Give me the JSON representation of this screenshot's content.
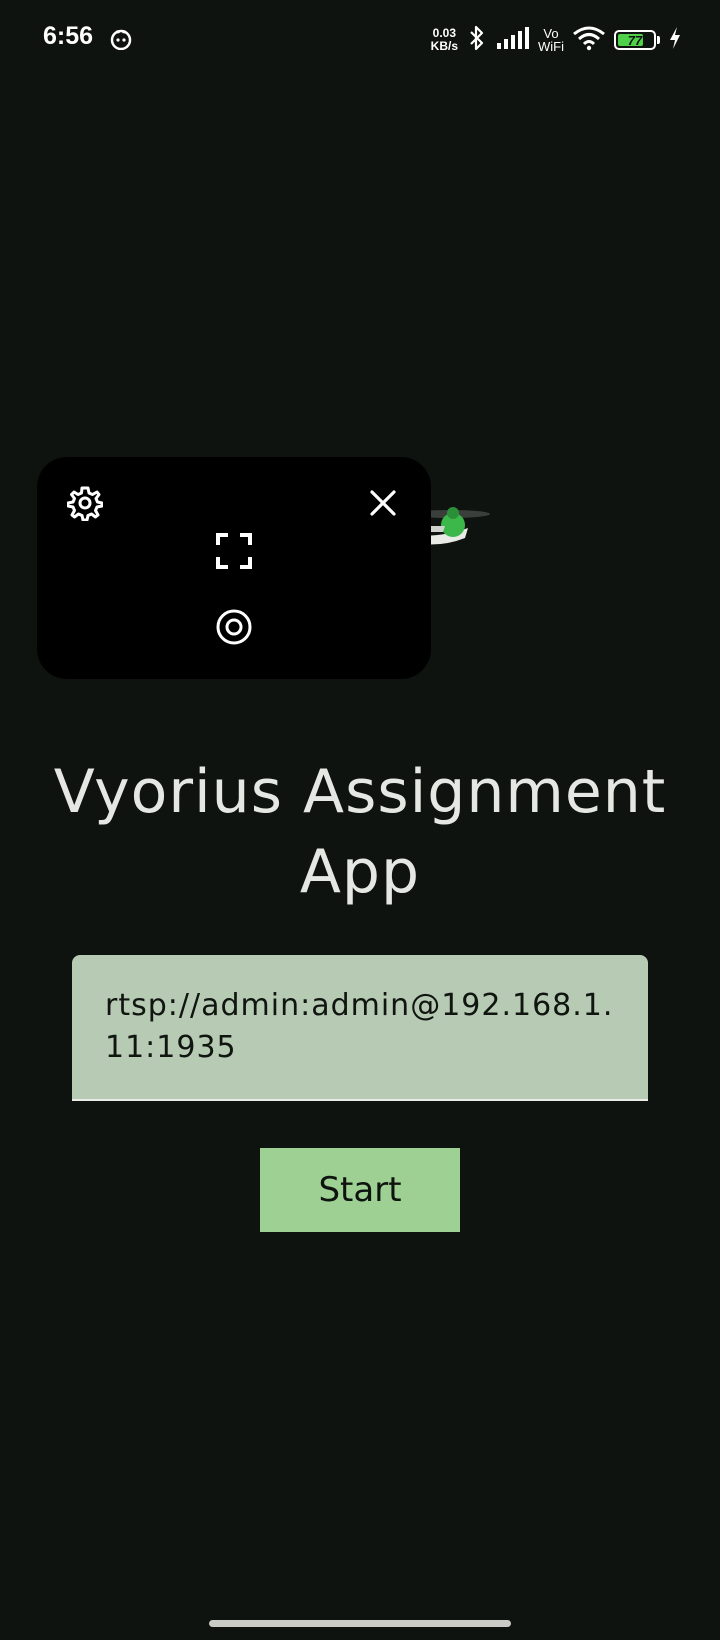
{
  "status_bar": {
    "time": "6:56",
    "net_speed_value": "0.03",
    "net_speed_unit": "KB/s",
    "vowifi_top": "Vo",
    "vowifi_bottom": "WiFi",
    "battery_level": "77",
    "battery_percent": 77,
    "icons": [
      "app-notification-icon",
      "bluetooth-icon",
      "signal-icon",
      "wifi-icon",
      "battery-icon",
      "charging-icon"
    ]
  },
  "overlay": {
    "icons": [
      "settings-icon",
      "close-icon",
      "fullscreen-icon",
      "record-icon"
    ]
  },
  "app": {
    "title": "Vyorius Assignment App"
  },
  "url_input": {
    "value": "rtsp://admin:admin@192.168.1.11:1935"
  },
  "start_button": {
    "label": "Start"
  },
  "colors": {
    "background": "#0e130f",
    "field_background": "#b6cab4",
    "button_background": "#9ed094",
    "drone_accent": "#3cb84a"
  }
}
